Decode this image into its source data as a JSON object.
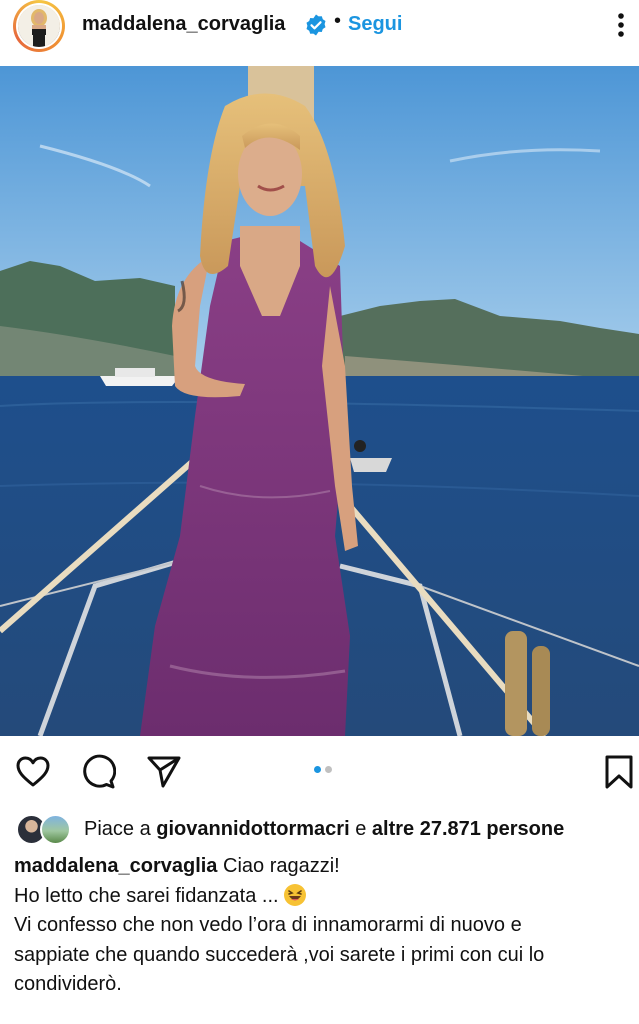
{
  "post_header": {
    "username": "maddalena_corvaglia",
    "separator": "•",
    "follow_label": "Segui",
    "verified_icon": "verified-badge-icon",
    "more_icon": "more-vertical-icon"
  },
  "post_image": {
    "subject_icon": "post-photo",
    "carousel_index": 1,
    "carousel_total": 2
  },
  "actions": {
    "like_icon": "heart-icon",
    "comment_icon": "comment-icon",
    "share_icon": "send-icon",
    "save_icon": "bookmark-icon"
  },
  "likes": {
    "prefix": "Piace a",
    "liker": "giovannidottormacri",
    "joiner": "e",
    "others": "altre 27.871 persone"
  },
  "caption": {
    "username": "maddalena_corvaglia",
    "line1": "Ciao ragazzi!",
    "line2": "Ho letto che sarei fidanzata ...",
    "line3": "Vi confesso che non vedo l’ora di innamorarmi di nuovo e",
    "line4": "sappiate che quando succederà ,voi sarete i primi con  cui lo",
    "line5": "condividerò."
  },
  "colors": {
    "accent": "#1b95e0",
    "text": "#111111",
    "dot_inactive": "#c0c0c0"
  }
}
